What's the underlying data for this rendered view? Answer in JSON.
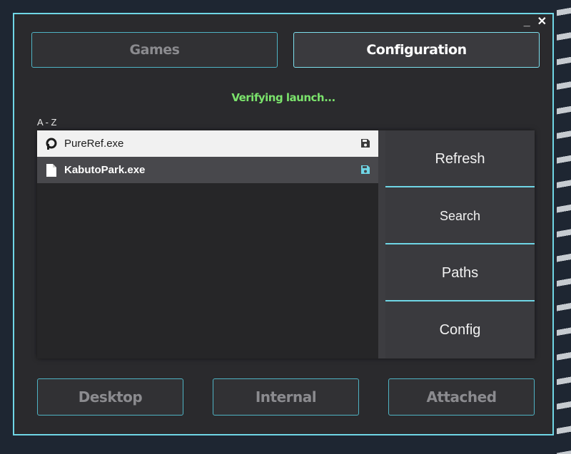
{
  "window": {
    "minimize_label": "_",
    "close_label": "✕"
  },
  "tabs": [
    {
      "label": "Games",
      "active": false
    },
    {
      "label": "Configuration",
      "active": true
    }
  ],
  "status": {
    "text": "Verifying launch..."
  },
  "sort": {
    "label": "A - Z"
  },
  "list": {
    "items": [
      {
        "name": "PureRef.exe",
        "icon": "pureref-icon",
        "save_icon": "save-icon",
        "save_color": "#3a3a3a"
      },
      {
        "name": "KabutoPark.exe",
        "icon": "file-icon",
        "save_icon": "save-icon",
        "save_color": "#6fd6e6"
      }
    ]
  },
  "side": {
    "buttons": [
      {
        "label": "Refresh"
      },
      {
        "label": "Search"
      },
      {
        "label": "Paths"
      },
      {
        "label": "Config"
      }
    ]
  },
  "bottom": {
    "buttons": [
      {
        "label": "Desktop"
      },
      {
        "label": "Internal"
      },
      {
        "label": "Attached"
      }
    ]
  },
  "colors": {
    "accent": "#6fd6e6",
    "status": "#7be36c",
    "window_bg": "#2a2a2d"
  }
}
